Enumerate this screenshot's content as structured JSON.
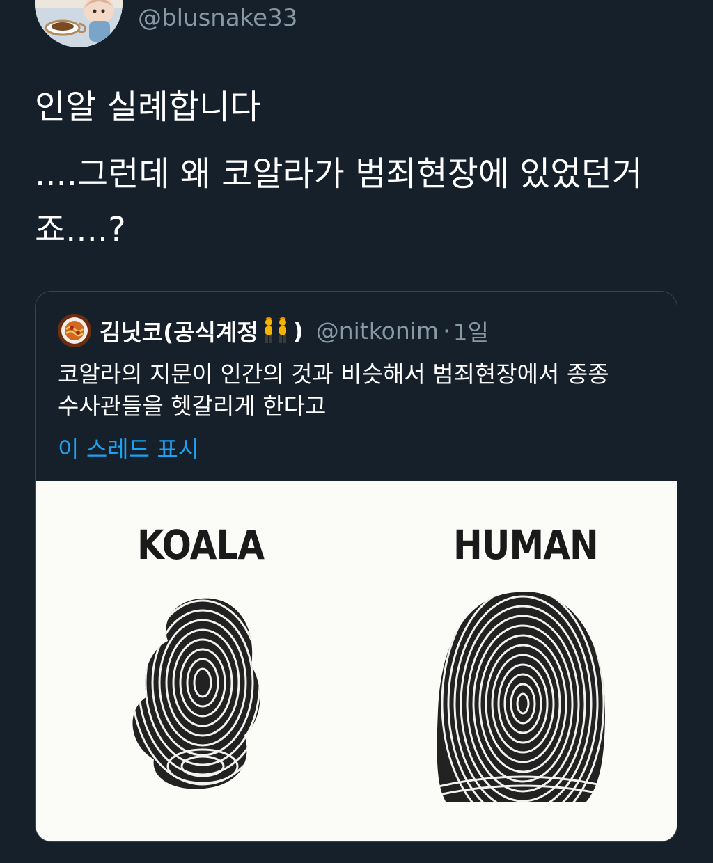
{
  "tweet": {
    "handle": "@blusnake33",
    "lines": [
      "인알 실례합니다",
      "....그런데 왜 코알라가 범죄현장에 있었던거",
      "죠....?"
    ]
  },
  "quoted_tweet": {
    "name": "김닛코(공식계정",
    "name_close": ")",
    "handle": "@nitkonim",
    "separator": "·",
    "time": "1일",
    "text_lines": [
      "코알라의 지문이 인간의 것과 비슷해서 범죄현장에서 종종",
      "수사관들을 헷갈리게 한다고"
    ],
    "show_thread": "이 스레드 표시",
    "image": {
      "left_label": "KOALA",
      "right_label": "HUMAN"
    }
  },
  "colors": {
    "background": "#15202b",
    "secondary_text": "#8899a6",
    "link": "#1da1f2",
    "border": "#38444d"
  }
}
